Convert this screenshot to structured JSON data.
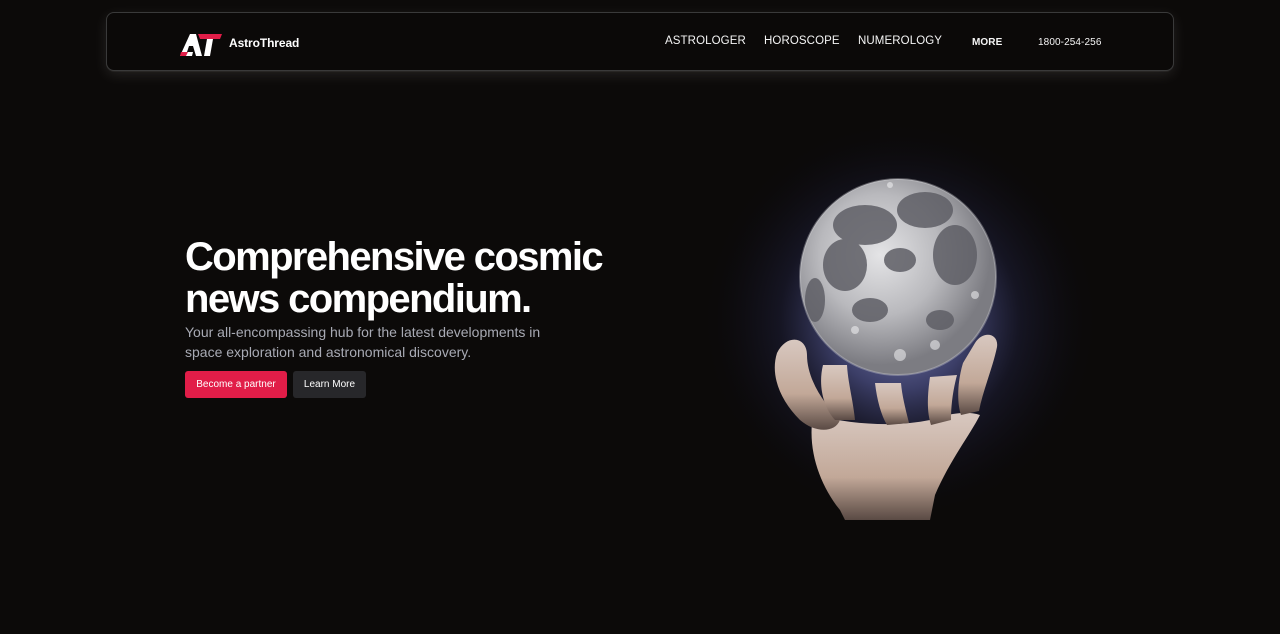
{
  "brand": {
    "name": "AstroThread",
    "logo_icon": "astrothread-logo-icon",
    "accent_color": "#e11d48"
  },
  "nav": {
    "links": [
      "ASTROLOGER",
      "HOROSCOPE",
      "NUMEROLOGY"
    ],
    "more_label": "MORE",
    "phone": "1800-254-256"
  },
  "hero": {
    "title_lines": [
      "Comprehensive cosmic",
      "news compendium."
    ],
    "subtitle_lines": [
      "Your all-encompassing hub for the latest developments in",
      "space exploration and astronomical discovery."
    ],
    "primary_button": "Become a partner",
    "secondary_button": "Learn More",
    "image_icon": "hand-holding-moon-image"
  },
  "colors": {
    "background": "#0c0a09",
    "primary_button": "#e11d48",
    "secondary_button": "#27272a",
    "subtitle_text": "#a8aab4"
  }
}
